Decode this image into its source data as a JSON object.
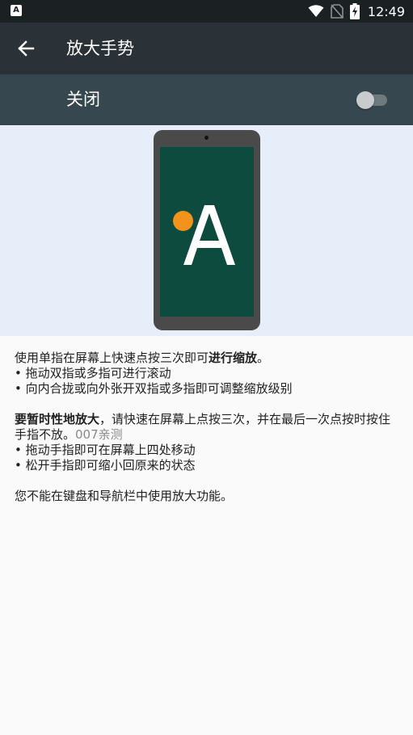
{
  "status_bar": {
    "left_icon": "A",
    "time": "12:49",
    "icons": [
      "wifi-icon",
      "no-sim-icon",
      "battery-charging-icon"
    ]
  },
  "app_bar": {
    "back_icon": "arrow-left-icon",
    "title": "放大手势"
  },
  "toggle_row": {
    "label": "关闭",
    "state": "off"
  },
  "illustration": {
    "letter": "A",
    "colors": {
      "background": "#e7eef9",
      "phone": "#4a4a4a",
      "screen": "#0d4b3f",
      "dot": "#f3931c",
      "letter": "#ffffff"
    }
  },
  "description": {
    "para1": {
      "intro": "使用单指在屏幕上快速点按三次即可",
      "intro_bold": "进行缩放",
      "intro_end": "。",
      "bullets": [
        "• 拖动双指或多指可进行滚动",
        "• 向内合拢或向外张开双指或多指即可调整缩放级别"
      ]
    },
    "para2": {
      "bold": "要暂时性地放大",
      "text": "，请快速在屏幕上点按三次，并在最后一次点按时按住手指不放。",
      "watermark": "007亲测",
      "bullets": [
        "• 拖动手指即可在屏幕上四处移动",
        "• 松开手指即可缩小回原来的状态"
      ]
    },
    "para3": "您不能在键盘和导航栏中使用放大功能。"
  },
  "colors": {
    "status_bar": "#1b2023",
    "app_bar": "#2a3237",
    "switch_bar": "#37474f",
    "page_background": "#fafafa",
    "text": "#212121"
  }
}
